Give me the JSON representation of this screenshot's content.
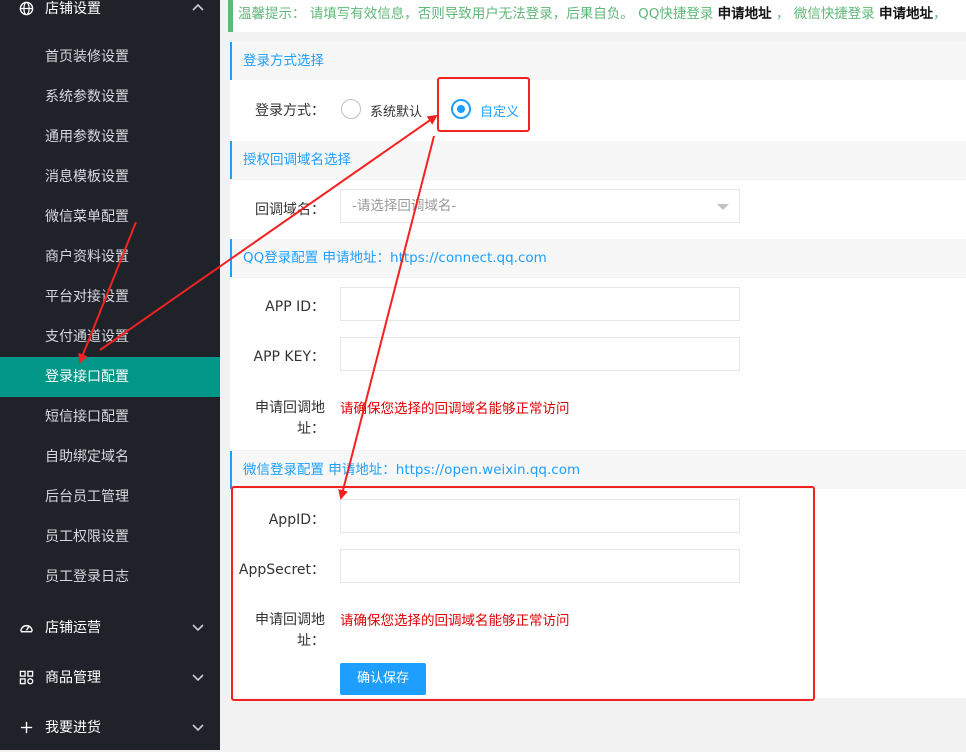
{
  "sidebar": {
    "group_top": {
      "label": "店铺设置",
      "icon": "globe-icon"
    },
    "items": [
      {
        "label": "首页装修设置"
      },
      {
        "label": "系统参数设置"
      },
      {
        "label": "通用参数设置"
      },
      {
        "label": "消息模板设置"
      },
      {
        "label": "微信菜单配置"
      },
      {
        "label": "商户资料设置"
      },
      {
        "label": "平台对接设置"
      },
      {
        "label": "支付通道设置"
      },
      {
        "label": "登录接口配置",
        "active": true
      },
      {
        "label": "短信接口配置"
      },
      {
        "label": "自助绑定域名"
      },
      {
        "label": "后台员工管理"
      },
      {
        "label": "员工权限设置"
      },
      {
        "label": "员工登录日志"
      }
    ],
    "groups": [
      {
        "label": "店铺运营",
        "icon": "gauge-icon"
      },
      {
        "label": "商品管理",
        "icon": "grid-icon"
      },
      {
        "label": "我要进货",
        "icon": "plus-icon"
      }
    ]
  },
  "notice": {
    "prefix": "温馨提示：",
    "text": "请填写有效信息，否则导致用户无法登录，后果自负。",
    "qq_label": "QQ快捷登录",
    "qq_link": "申请地址",
    "sep": "，",
    "wx_label": "微信快捷登录",
    "wx_link": "申请地址",
    "tail": "，"
  },
  "login_method": {
    "section_title": "登录方式选择",
    "label": "登录方式：",
    "options": [
      {
        "label": "系统默认",
        "checked": false
      },
      {
        "label": "自定义",
        "checked": true
      }
    ]
  },
  "callback_domain": {
    "section_title": "授权回调域名选择",
    "label": "回调域名：",
    "placeholder": "-请选择回调域名-"
  },
  "qq": {
    "section_title": "QQ登录配置 申请地址：https://connect.qq.com",
    "app_id_label": "APP ID：",
    "app_id_value": "",
    "app_key_label": "APP KEY：",
    "app_key_value": "",
    "callback_label_1": "申请回调地",
    "callback_label_2": "址：",
    "callback_warning": "请确保您选择的回调域名能够正常访问"
  },
  "weixin": {
    "section_title": "微信登录配置 申请地址：https://open.weixin.qq.com",
    "appid_label": "AppID：",
    "appid_value": "",
    "appsecret_label": "AppSecret：",
    "appsecret_value": "",
    "callback_label_1": "申请回调地",
    "callback_label_2": "址：",
    "callback_warning": "请确保您选择的回调域名能够正常访问",
    "save_label": "确认保存"
  },
  "colors": {
    "sidebar_bg": "#20222a",
    "active": "#009688",
    "accent": "#1e9fff",
    "notice": "#5fb878",
    "warn": "#e00000",
    "annotation": "#f32222"
  }
}
